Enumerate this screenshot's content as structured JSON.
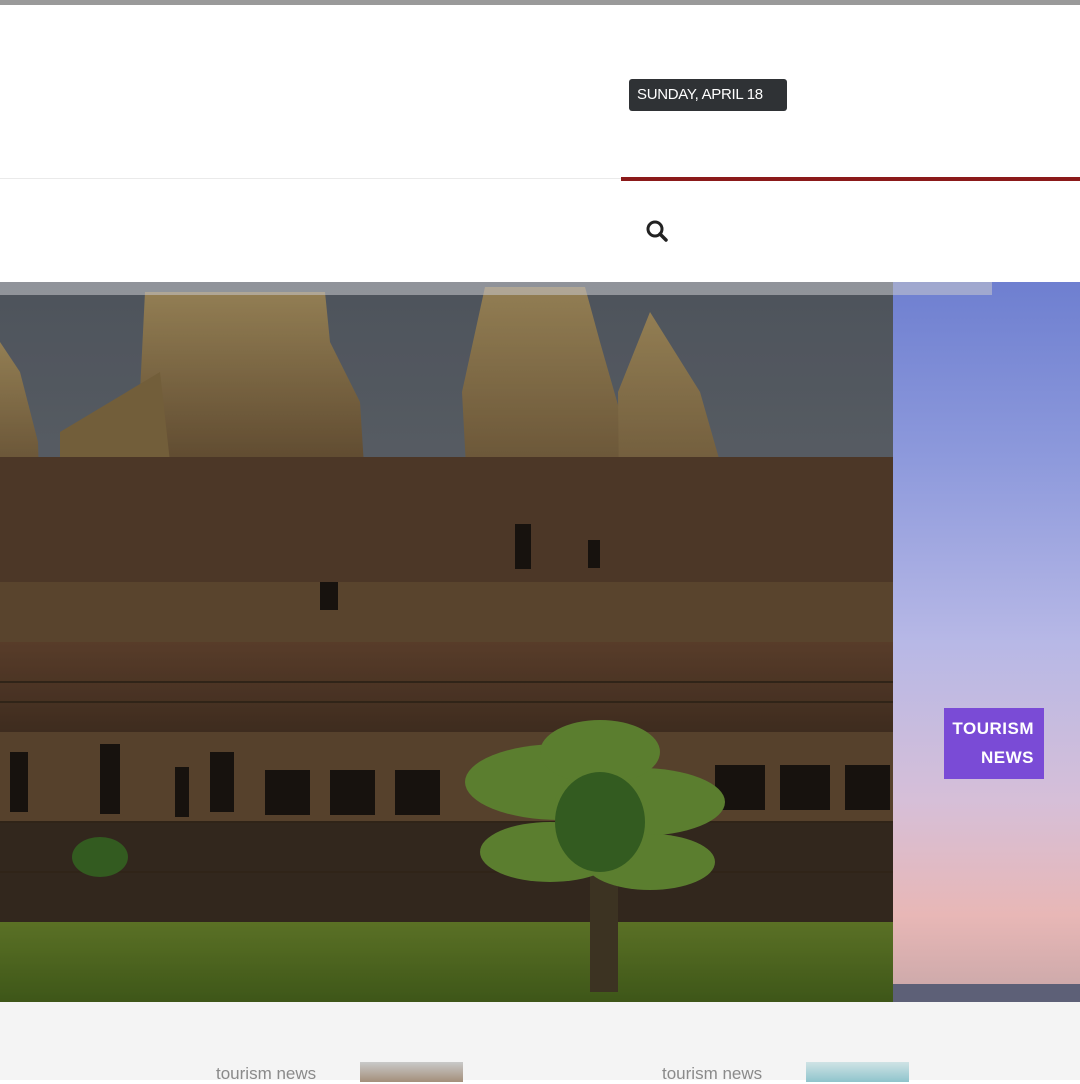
{
  "header": {
    "date": "SUNDAY, APRIL 18"
  },
  "nav": {
    "search_icon": "search-icon"
  },
  "slider": {
    "featured_category": {
      "line1": "TOURISM",
      "line2": "NEWS"
    }
  },
  "cards": [
    {
      "category": "tourism news"
    },
    {
      "category": "tourism news"
    }
  ],
  "colors": {
    "date_badge": "#2f3235",
    "accent_rule": "#8b1a1a",
    "category_badge": "#7a4bd6"
  }
}
